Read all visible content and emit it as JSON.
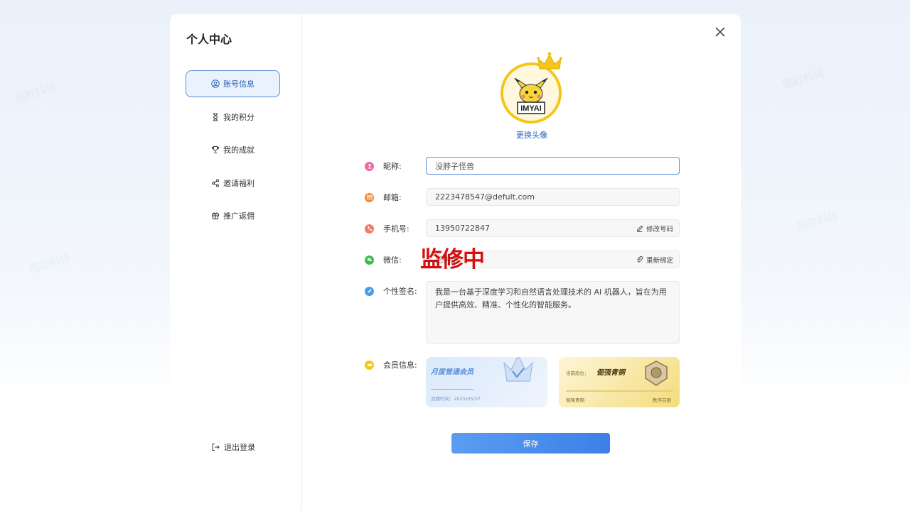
{
  "sidebar": {
    "title": "个人中心",
    "items": [
      {
        "label": "账号信息",
        "icon": "user-circle-icon",
        "active": true
      },
      {
        "label": "我的积分",
        "icon": "hourglass-icon",
        "active": false
      },
      {
        "label": "我的成就",
        "icon": "trophy-icon",
        "active": false
      },
      {
        "label": "邀请福利",
        "icon": "share-icon",
        "active": false
      },
      {
        "label": "推广返佣",
        "icon": "gift-icon",
        "active": false
      }
    ],
    "logout_label": "退出登录"
  },
  "avatar": {
    "logo_text": "IMYAI",
    "change_label": "更换头像"
  },
  "form": {
    "nickname": {
      "label": "昵称:",
      "value": "没脖子怪兽",
      "icon_color": "#e86aa6"
    },
    "email": {
      "label": "邮箱:",
      "value": "2223478547@defult.com",
      "icon_color": "#f08a3c"
    },
    "phone": {
      "label": "手机号:",
      "value": "13950722847",
      "action": "修改号码",
      "icon_color": "#f07a6a"
    },
    "wechat": {
      "label": "微信:",
      "value": "已绑定",
      "action": "重新绑定",
      "icon_color": "#3cbf4a"
    },
    "signature": {
      "label": "个性签名:",
      "value": "我是一台基于深度学习和自然语言处理技术的 AI 机器人，旨在为用户提供高效、精准、个性化的智能服务。",
      "icon_color": "#4a9ee8"
    },
    "membership": {
      "label": "会员信息:",
      "icon_color": "#f5c518"
    }
  },
  "cards": {
    "membership": {
      "title": "月度普通会员",
      "expiry": "到期时间：2025/05/07"
    },
    "rank": {
      "prefix": "当前段位：",
      "title": "倔强青铜",
      "current": "倔强青铜",
      "next": "秩序白银"
    }
  },
  "stamp_text": "监修中",
  "save_label": "保存",
  "watermark": "图欧科技"
}
